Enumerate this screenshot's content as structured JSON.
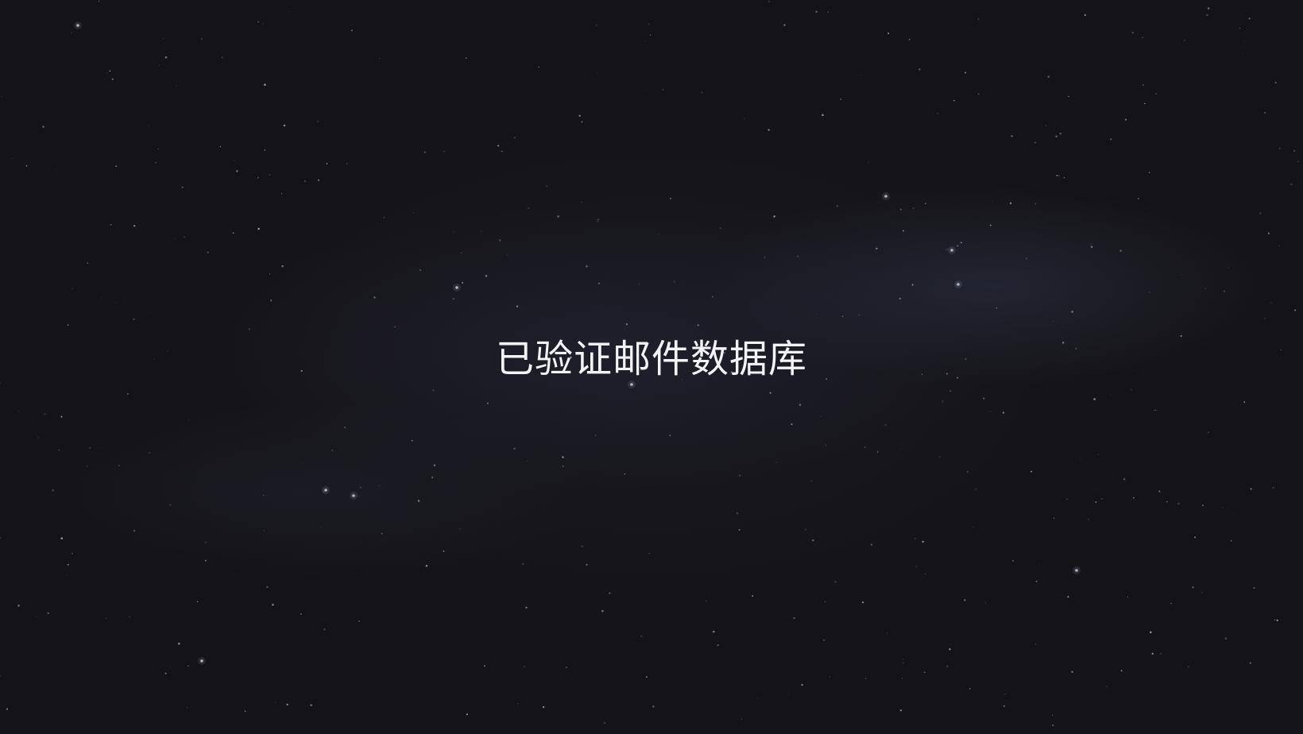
{
  "hero": {
    "title": "已验证邮件数据库"
  },
  "colors": {
    "background": "#141317",
    "title_text": "#f3f3f5",
    "star": "#c9cde0",
    "nebula": "#3a405c"
  }
}
